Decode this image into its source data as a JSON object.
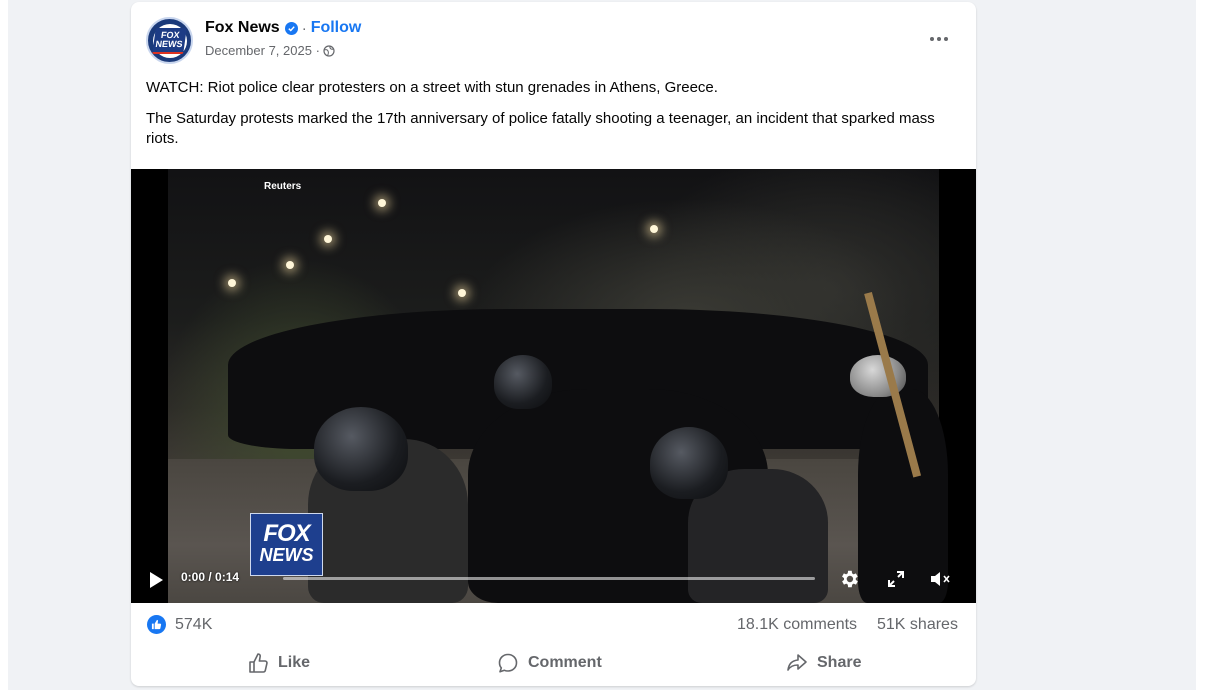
{
  "post": {
    "page_name": "Fox News",
    "follow_label": "Follow",
    "separator": "·",
    "date": "December 7, 2025 ·",
    "avatar_text": "FOX NEWS",
    "caption_line1": "WATCH: Riot police clear protesters on a street with stun grenades in Athens, Greece.",
    "caption_line2": "The Saturday protests marked the 17th anniversary of police fatally shooting a teenager, an incident that sparked mass riots.",
    "icons": {
      "verified": "verified-badge-icon",
      "privacy": "globe-icon",
      "more": "more-options-icon"
    }
  },
  "video": {
    "watermark": "Reuters",
    "bug_line1": "FOX",
    "bug_line2": "NEWS",
    "current_time": "0:00",
    "duration": "/ 0:14",
    "progress_fraction": 0.0,
    "icons": [
      "play-icon",
      "settings-gear-icon",
      "fullscreen-icon",
      "muted-speaker-icon"
    ]
  },
  "stats": {
    "reactions": "574K",
    "comments": "18.1K comments",
    "shares": "51K shares"
  },
  "actions": {
    "like": "Like",
    "comment": "Comment",
    "share": "Share"
  },
  "colors": {
    "accent": "#1877f2",
    "background": "#f0f2f5",
    "secondary_text": "#65676b",
    "fox_blue": "#1e3f8e"
  }
}
